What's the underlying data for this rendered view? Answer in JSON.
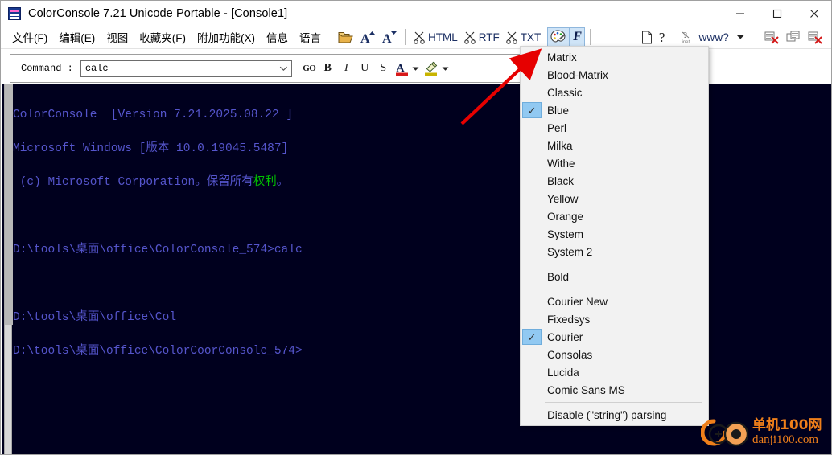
{
  "window": {
    "title": "ColorConsole 7.21 Unicode Portable - [Console1]",
    "icon": "console-app-icon",
    "controls": {
      "minimize": "minimize-icon",
      "maximize": "maximize-icon",
      "close": "close-icon"
    }
  },
  "menubar": {
    "items": [
      {
        "label": "文件(F)",
        "name": "menu-file"
      },
      {
        "label": "编辑(E)",
        "name": "menu-edit"
      },
      {
        "label": "视图",
        "name": "menu-view"
      },
      {
        "label": "收藏夹(F)",
        "name": "menu-favorites"
      },
      {
        "label": "附加功能(X)",
        "name": "menu-addons"
      },
      {
        "label": "信息",
        "name": "menu-info"
      },
      {
        "label": "语言",
        "name": "menu-language"
      }
    ]
  },
  "toolbar": {
    "open_icon": "folder-open-icon",
    "font_increase_icon": "font-increase-icon",
    "font_decrease_icon": "font-decrease-icon",
    "export_html": "HTML",
    "export_rtf": "RTF",
    "export_txt": "TXT",
    "scissors_icon": "scissors-icon",
    "palette_icon": "color-palette-icon",
    "font_icon": "font-F-icon",
    "new_doc_icon": "new-document-icon",
    "help_icon": "help-question-icon",
    "inet_icon": "internet-icon",
    "www_label": "www?",
    "www_arrow_icon": "chevron-down-icon",
    "close_tab_icon": "close-tab-icon",
    "duplicate_tab_icon": "duplicate-tab-icon",
    "close_all_tabs_icon": "close-all-tabs-icon"
  },
  "command_bar": {
    "label": "Command :",
    "value": "calc",
    "placeholder": "",
    "dropdown_icon": "chevron-down-icon",
    "buttons": {
      "go": "GO",
      "bold": "B",
      "italic": "I",
      "underline": "U",
      "strike": "S",
      "font_color_icon": "font-color-icon",
      "highlight_icon": "highlighter-icon",
      "font_color": "#d81a1a",
      "highlight_color": "#c8b400"
    }
  },
  "console": {
    "background": "#00001e",
    "text_color": "#5555cc",
    "highlight_color": "#00c000",
    "lines": [
      {
        "text": "ColorConsole  [Version 7.21.2025.08.22 ]"
      },
      {
        "text": "Microsoft Windows [版本 10.0.19045.5487]"
      },
      {
        "pre": " (c) Microsoft Corporation。保留所有",
        "hl": "权利",
        "post": "。"
      },
      {
        "text": ""
      },
      {
        "text": "D:\\tools\\桌面\\office\\ColorConsole_574>calc"
      },
      {
        "text": ""
      },
      {
        "text": "D:\\tools\\桌面\\office\\Col"
      },
      {
        "text": "D:\\tools\\桌面\\office\\ColorCoorConsole_574>"
      }
    ]
  },
  "popup_menu": {
    "name": "color-scheme-menu",
    "items": [
      {
        "label": "Matrix",
        "checked": false,
        "type": "item"
      },
      {
        "label": "Blood-Matrix",
        "checked": false,
        "type": "item"
      },
      {
        "label": "Classic",
        "checked": false,
        "type": "item"
      },
      {
        "label": "Blue",
        "checked": true,
        "type": "item"
      },
      {
        "label": "Perl",
        "checked": false,
        "type": "item"
      },
      {
        "label": "Milka",
        "checked": false,
        "type": "item"
      },
      {
        "label": "Withe",
        "checked": false,
        "type": "item"
      },
      {
        "label": "Black",
        "checked": false,
        "type": "item"
      },
      {
        "label": "Yellow",
        "checked": false,
        "type": "item"
      },
      {
        "label": "Orange",
        "checked": false,
        "type": "item"
      },
      {
        "label": "System",
        "checked": false,
        "type": "item"
      },
      {
        "label": "System 2",
        "checked": false,
        "type": "item"
      },
      {
        "type": "separator"
      },
      {
        "label": "Bold",
        "checked": false,
        "type": "item"
      },
      {
        "type": "separator"
      },
      {
        "label": "Courier New",
        "checked": false,
        "type": "item"
      },
      {
        "label": "Fixedsys",
        "checked": false,
        "type": "item"
      },
      {
        "label": "Courier",
        "checked": true,
        "type": "item"
      },
      {
        "label": "Consolas",
        "checked": false,
        "type": "item"
      },
      {
        "label": "Lucida",
        "checked": false,
        "type": "item"
      },
      {
        "label": "Comic Sans MS",
        "checked": false,
        "type": "item"
      },
      {
        "type": "separator"
      },
      {
        "label": "Disable (\"string\") parsing",
        "checked": false,
        "type": "item"
      }
    ],
    "check_glyph": "✓"
  },
  "annotation": {
    "arrow": "red-arrow-pointing-to-matrix",
    "color": "#e60000"
  },
  "watermark": {
    "line1": "单机100网",
    "line2": "danji100.com",
    "color": "#ef7f1a"
  }
}
